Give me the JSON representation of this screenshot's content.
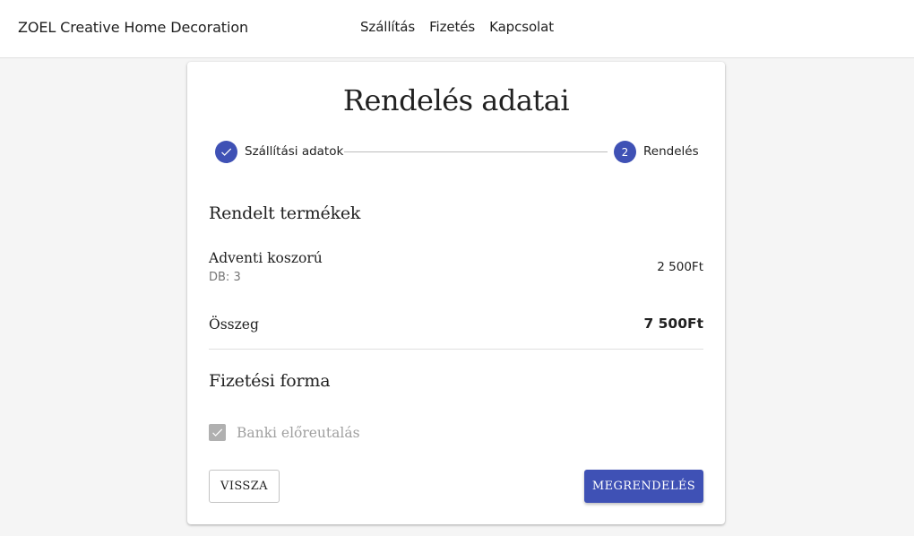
{
  "header": {
    "brand": "ZOEL Creative Home Decoration",
    "nav": [
      "Szállítás",
      "Fizetés",
      "Kapcsolat"
    ]
  },
  "card": {
    "title": "Rendelés adatai",
    "stepper": {
      "steps": [
        {
          "label": "Szállítási adatok",
          "state": "completed",
          "icon": "check-icon"
        },
        {
          "label": "Rendelés",
          "state": "active",
          "number": "2"
        }
      ]
    },
    "ordered_products": {
      "title": "Rendelt termékek",
      "items": [
        {
          "name": "Adventi koszorú",
          "quantity": "DB: 3",
          "price": "2 500Ft"
        }
      ]
    },
    "total": {
      "label": "Összeg",
      "value": "7 500Ft"
    },
    "payment": {
      "title": "Fizetési forma",
      "option": {
        "label": "Banki előreutalás",
        "checked": true,
        "disabled": true
      }
    },
    "buttons": {
      "back": "VISSZA",
      "order": "MEGRENDELÉS"
    }
  },
  "colors": {
    "accent": "#3f51b5",
    "background": "#f5f5f5",
    "disabled": "#b0b0b0"
  }
}
